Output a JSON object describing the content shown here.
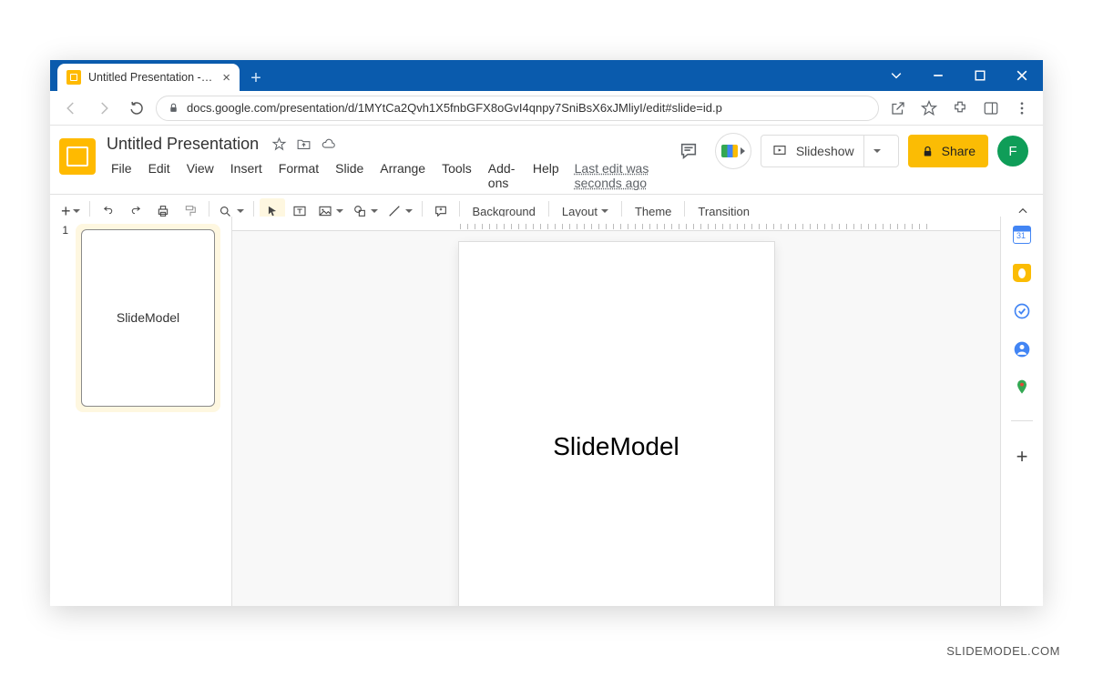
{
  "browser": {
    "tab_title": "Untitled Presentation - Google S",
    "url": "docs.google.com/presentation/d/1MYtCa2Qvh1X5fnbGFX8oGvI4qnpy7SniBsX6xJMliyI/edit#slide=id.p"
  },
  "app": {
    "doc_title": "Untitled Presentation",
    "last_edit": "Last edit was seconds ago",
    "menus": [
      "File",
      "Edit",
      "View",
      "Insert",
      "Format",
      "Slide",
      "Arrange",
      "Tools",
      "Add-ons",
      "Help"
    ],
    "slideshow_label": "Slideshow",
    "share_label": "Share",
    "avatar_initial": "F"
  },
  "toolbar": {
    "background": "Background",
    "layout": "Layout",
    "theme": "Theme",
    "transition": "Transition"
  },
  "thumb": {
    "number": "1",
    "text": "SlideModel"
  },
  "slide": {
    "text": "SlideModel"
  },
  "watermark": "SLIDEMODEL.COM"
}
